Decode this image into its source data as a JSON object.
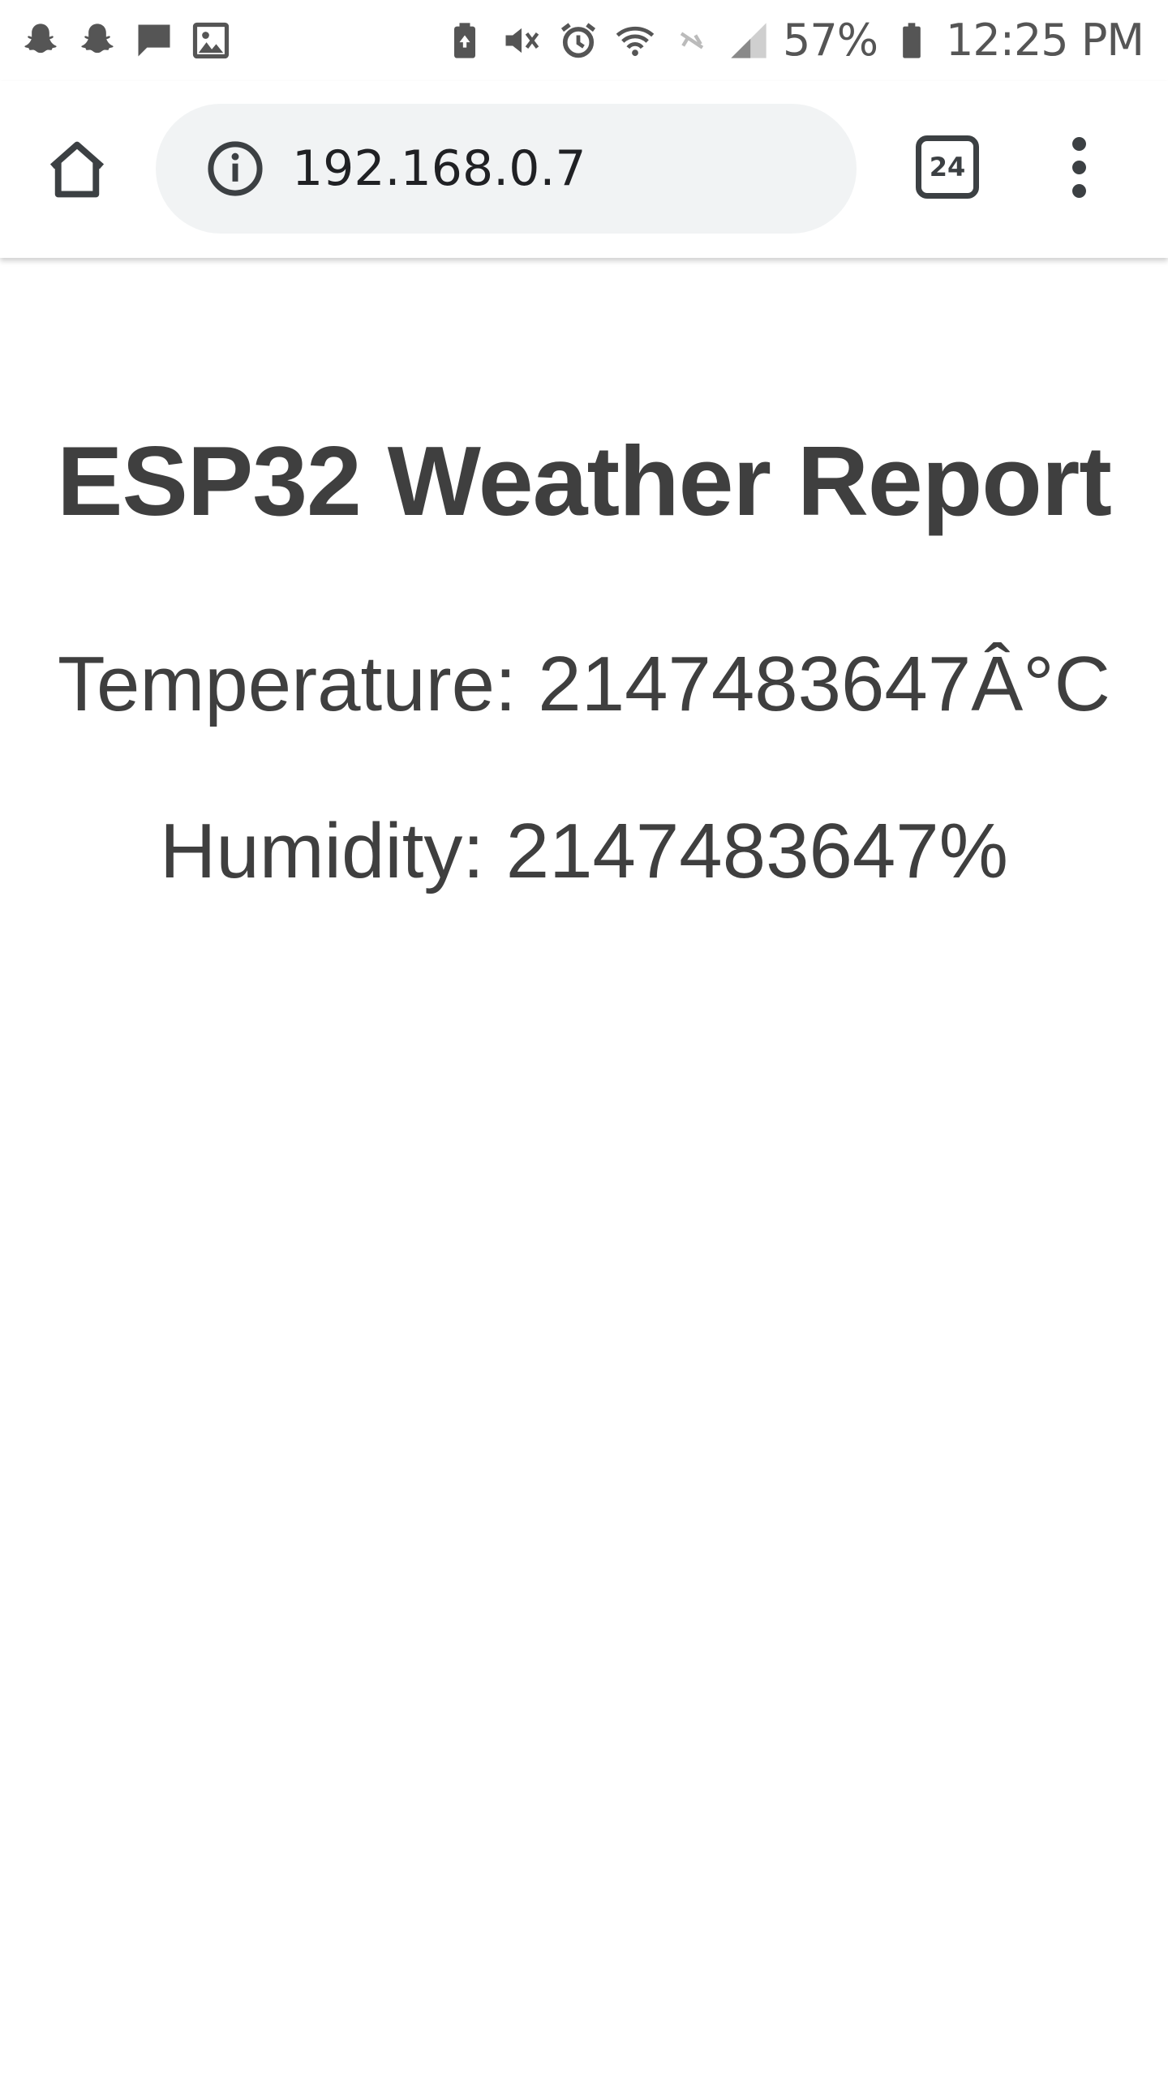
{
  "status_bar": {
    "left_icons": [
      "snapchat-icon",
      "snapchat-icon",
      "message-icon",
      "gallery-icon"
    ],
    "right_icons": [
      "battery-saver-icon",
      "vibrate-mute-icon",
      "alarm-icon",
      "wifi-icon",
      "mobile-data-off-icon",
      "signal-icon"
    ],
    "battery_percent": "57%",
    "time": "12:25 PM"
  },
  "browser": {
    "url": "192.168.0.7",
    "tab_count": "24",
    "icons": {
      "home": "home-icon",
      "info": "info-icon",
      "menu": "overflow-menu-icon"
    }
  },
  "page": {
    "title": "ESP32 Weather Report",
    "temperature_text": "Temperature: 2147483647Â°C",
    "humidity_text": "Humidity: 2147483647%"
  },
  "colors": {
    "text": "#3f3f3f",
    "omnibox_bg": "#f1f3f4",
    "icon": "#3c4043"
  }
}
